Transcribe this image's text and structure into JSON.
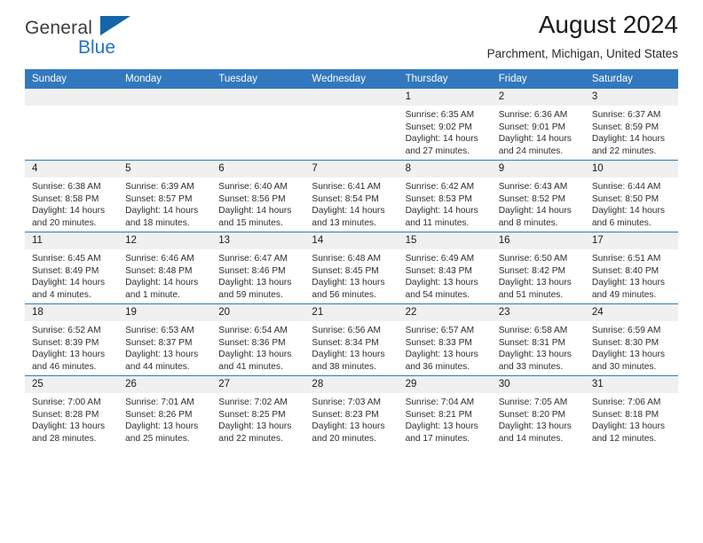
{
  "brand": {
    "name_part1": "General",
    "name_part2": "Blue",
    "accent_color": "#2175c4",
    "triangle_color": "#1565a8"
  },
  "header": {
    "title": "August 2024",
    "location": "Parchment, Michigan, United States"
  },
  "theme": {
    "header_row_color": "#3278be",
    "daynum_band_color": "#f0f0f0",
    "grid_line_color": "#3278be"
  },
  "weekday_headers": [
    "Sunday",
    "Monday",
    "Tuesday",
    "Wednesday",
    "Thursday",
    "Friday",
    "Saturday"
  ],
  "weeks": [
    [
      {
        "day": "",
        "empty": true,
        "sunrise": "",
        "sunset": "",
        "daylight_line1": "",
        "daylight_line2": ""
      },
      {
        "day": "",
        "empty": true,
        "sunrise": "",
        "sunset": "",
        "daylight_line1": "",
        "daylight_line2": ""
      },
      {
        "day": "",
        "empty": true,
        "sunrise": "",
        "sunset": "",
        "daylight_line1": "",
        "daylight_line2": ""
      },
      {
        "day": "",
        "empty": true,
        "sunrise": "",
        "sunset": "",
        "daylight_line1": "",
        "daylight_line2": ""
      },
      {
        "day": "1",
        "empty": false,
        "sunrise": "Sunrise: 6:35 AM",
        "sunset": "Sunset: 9:02 PM",
        "daylight_line1": "Daylight: 14 hours",
        "daylight_line2": "and 27 minutes."
      },
      {
        "day": "2",
        "empty": false,
        "sunrise": "Sunrise: 6:36 AM",
        "sunset": "Sunset: 9:01 PM",
        "daylight_line1": "Daylight: 14 hours",
        "daylight_line2": "and 24 minutes."
      },
      {
        "day": "3",
        "empty": false,
        "sunrise": "Sunrise: 6:37 AM",
        "sunset": "Sunset: 8:59 PM",
        "daylight_line1": "Daylight: 14 hours",
        "daylight_line2": "and 22 minutes."
      }
    ],
    [
      {
        "day": "4",
        "empty": false,
        "sunrise": "Sunrise: 6:38 AM",
        "sunset": "Sunset: 8:58 PM",
        "daylight_line1": "Daylight: 14 hours",
        "daylight_line2": "and 20 minutes."
      },
      {
        "day": "5",
        "empty": false,
        "sunrise": "Sunrise: 6:39 AM",
        "sunset": "Sunset: 8:57 PM",
        "daylight_line1": "Daylight: 14 hours",
        "daylight_line2": "and 18 minutes."
      },
      {
        "day": "6",
        "empty": false,
        "sunrise": "Sunrise: 6:40 AM",
        "sunset": "Sunset: 8:56 PM",
        "daylight_line1": "Daylight: 14 hours",
        "daylight_line2": "and 15 minutes."
      },
      {
        "day": "7",
        "empty": false,
        "sunrise": "Sunrise: 6:41 AM",
        "sunset": "Sunset: 8:54 PM",
        "daylight_line1": "Daylight: 14 hours",
        "daylight_line2": "and 13 minutes."
      },
      {
        "day": "8",
        "empty": false,
        "sunrise": "Sunrise: 6:42 AM",
        "sunset": "Sunset: 8:53 PM",
        "daylight_line1": "Daylight: 14 hours",
        "daylight_line2": "and 11 minutes."
      },
      {
        "day": "9",
        "empty": false,
        "sunrise": "Sunrise: 6:43 AM",
        "sunset": "Sunset: 8:52 PM",
        "daylight_line1": "Daylight: 14 hours",
        "daylight_line2": "and 8 minutes."
      },
      {
        "day": "10",
        "empty": false,
        "sunrise": "Sunrise: 6:44 AM",
        "sunset": "Sunset: 8:50 PM",
        "daylight_line1": "Daylight: 14 hours",
        "daylight_line2": "and 6 minutes."
      }
    ],
    [
      {
        "day": "11",
        "empty": false,
        "sunrise": "Sunrise: 6:45 AM",
        "sunset": "Sunset: 8:49 PM",
        "daylight_line1": "Daylight: 14 hours",
        "daylight_line2": "and 4 minutes."
      },
      {
        "day": "12",
        "empty": false,
        "sunrise": "Sunrise: 6:46 AM",
        "sunset": "Sunset: 8:48 PM",
        "daylight_line1": "Daylight: 14 hours",
        "daylight_line2": "and 1 minute."
      },
      {
        "day": "13",
        "empty": false,
        "sunrise": "Sunrise: 6:47 AM",
        "sunset": "Sunset: 8:46 PM",
        "daylight_line1": "Daylight: 13 hours",
        "daylight_line2": "and 59 minutes."
      },
      {
        "day": "14",
        "empty": false,
        "sunrise": "Sunrise: 6:48 AM",
        "sunset": "Sunset: 8:45 PM",
        "daylight_line1": "Daylight: 13 hours",
        "daylight_line2": "and 56 minutes."
      },
      {
        "day": "15",
        "empty": false,
        "sunrise": "Sunrise: 6:49 AM",
        "sunset": "Sunset: 8:43 PM",
        "daylight_line1": "Daylight: 13 hours",
        "daylight_line2": "and 54 minutes."
      },
      {
        "day": "16",
        "empty": false,
        "sunrise": "Sunrise: 6:50 AM",
        "sunset": "Sunset: 8:42 PM",
        "daylight_line1": "Daylight: 13 hours",
        "daylight_line2": "and 51 minutes."
      },
      {
        "day": "17",
        "empty": false,
        "sunrise": "Sunrise: 6:51 AM",
        "sunset": "Sunset: 8:40 PM",
        "daylight_line1": "Daylight: 13 hours",
        "daylight_line2": "and 49 minutes."
      }
    ],
    [
      {
        "day": "18",
        "empty": false,
        "sunrise": "Sunrise: 6:52 AM",
        "sunset": "Sunset: 8:39 PM",
        "daylight_line1": "Daylight: 13 hours",
        "daylight_line2": "and 46 minutes."
      },
      {
        "day": "19",
        "empty": false,
        "sunrise": "Sunrise: 6:53 AM",
        "sunset": "Sunset: 8:37 PM",
        "daylight_line1": "Daylight: 13 hours",
        "daylight_line2": "and 44 minutes."
      },
      {
        "day": "20",
        "empty": false,
        "sunrise": "Sunrise: 6:54 AM",
        "sunset": "Sunset: 8:36 PM",
        "daylight_line1": "Daylight: 13 hours",
        "daylight_line2": "and 41 minutes."
      },
      {
        "day": "21",
        "empty": false,
        "sunrise": "Sunrise: 6:56 AM",
        "sunset": "Sunset: 8:34 PM",
        "daylight_line1": "Daylight: 13 hours",
        "daylight_line2": "and 38 minutes."
      },
      {
        "day": "22",
        "empty": false,
        "sunrise": "Sunrise: 6:57 AM",
        "sunset": "Sunset: 8:33 PM",
        "daylight_line1": "Daylight: 13 hours",
        "daylight_line2": "and 36 minutes."
      },
      {
        "day": "23",
        "empty": false,
        "sunrise": "Sunrise: 6:58 AM",
        "sunset": "Sunset: 8:31 PM",
        "daylight_line1": "Daylight: 13 hours",
        "daylight_line2": "and 33 minutes."
      },
      {
        "day": "24",
        "empty": false,
        "sunrise": "Sunrise: 6:59 AM",
        "sunset": "Sunset: 8:30 PM",
        "daylight_line1": "Daylight: 13 hours",
        "daylight_line2": "and 30 minutes."
      }
    ],
    [
      {
        "day": "25",
        "empty": false,
        "sunrise": "Sunrise: 7:00 AM",
        "sunset": "Sunset: 8:28 PM",
        "daylight_line1": "Daylight: 13 hours",
        "daylight_line2": "and 28 minutes."
      },
      {
        "day": "26",
        "empty": false,
        "sunrise": "Sunrise: 7:01 AM",
        "sunset": "Sunset: 8:26 PM",
        "daylight_line1": "Daylight: 13 hours",
        "daylight_line2": "and 25 minutes."
      },
      {
        "day": "27",
        "empty": false,
        "sunrise": "Sunrise: 7:02 AM",
        "sunset": "Sunset: 8:25 PM",
        "daylight_line1": "Daylight: 13 hours",
        "daylight_line2": "and 22 minutes."
      },
      {
        "day": "28",
        "empty": false,
        "sunrise": "Sunrise: 7:03 AM",
        "sunset": "Sunset: 8:23 PM",
        "daylight_line1": "Daylight: 13 hours",
        "daylight_line2": "and 20 minutes."
      },
      {
        "day": "29",
        "empty": false,
        "sunrise": "Sunrise: 7:04 AM",
        "sunset": "Sunset: 8:21 PM",
        "daylight_line1": "Daylight: 13 hours",
        "daylight_line2": "and 17 minutes."
      },
      {
        "day": "30",
        "empty": false,
        "sunrise": "Sunrise: 7:05 AM",
        "sunset": "Sunset: 8:20 PM",
        "daylight_line1": "Daylight: 13 hours",
        "daylight_line2": "and 14 minutes."
      },
      {
        "day": "31",
        "empty": false,
        "sunrise": "Sunrise: 7:06 AM",
        "sunset": "Sunset: 8:18 PM",
        "daylight_line1": "Daylight: 13 hours",
        "daylight_line2": "and 12 minutes."
      }
    ]
  ]
}
